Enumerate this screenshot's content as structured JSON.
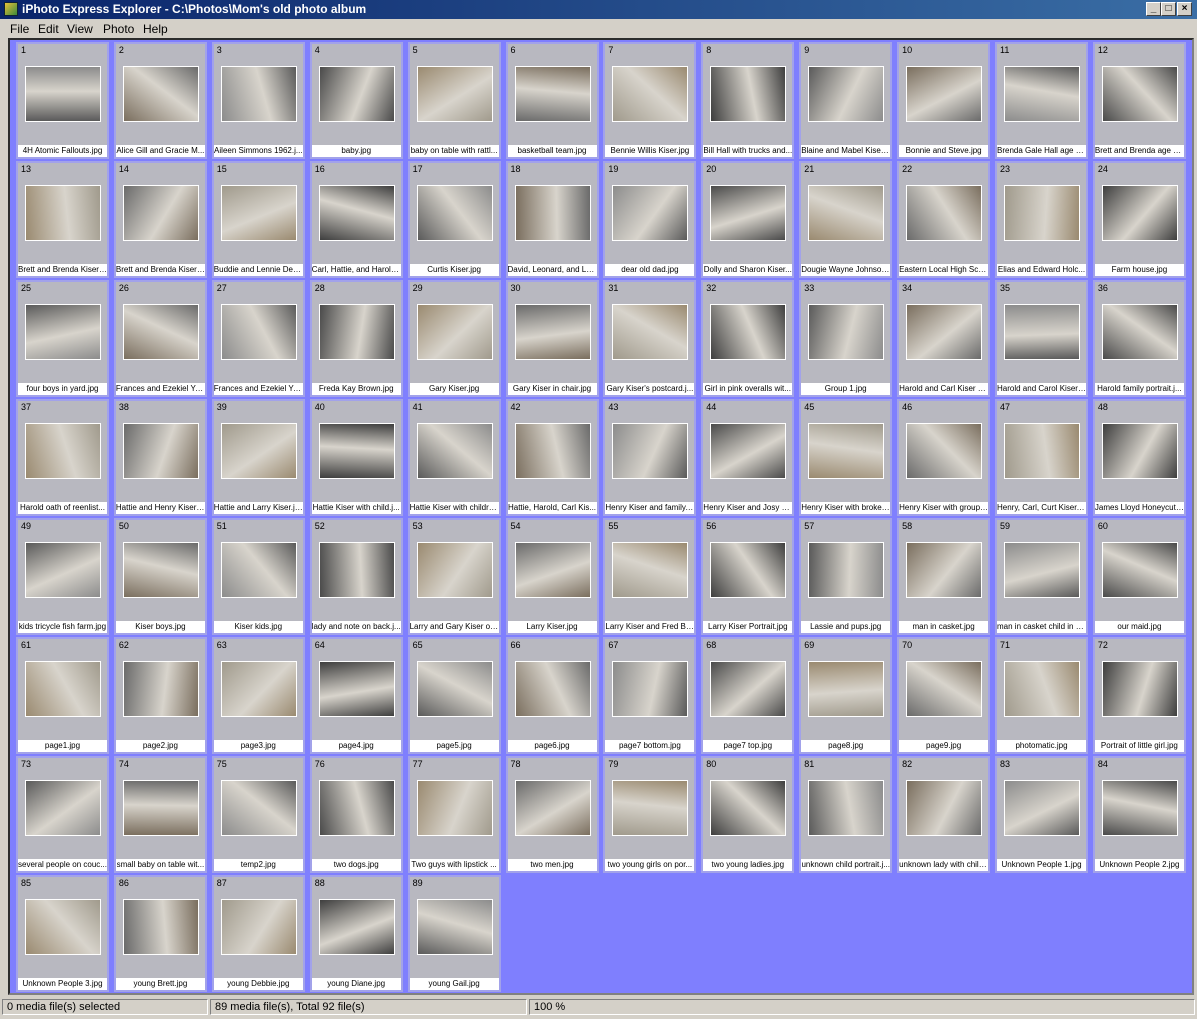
{
  "window": {
    "title": "iPhoto Express Explorer - C:\\Photos\\Mom's old photo album"
  },
  "menu": [
    "File",
    "Edit",
    "View",
    "Photo",
    "Help"
  ],
  "colors": {
    "grid_background": "#7f7ffe",
    "tile_background": "#b8b8c0",
    "titlebar": "#0a246a"
  },
  "photos": [
    "4H Atomic Fallouts.jpg",
    "Alice Gill and Gracie M...",
    "Aileen Simmons 1962.j...",
    "baby.jpg",
    "baby on table with rattl...",
    "basketball team.jpg",
    "Bennie Willis Kiser.jpg",
    "Bill Hall with trucks and...",
    "Blaine and Mabel Kiser ...",
    "Bonnie and Steve.jpg",
    "Brenda Gale Hall age 1...",
    "Brett and Brenda age 1...",
    "Brett and Brenda Kiser ...",
    "Brett and Brenda Kiser ...",
    "Buddie and Lennie Des...",
    "Carl, Hattie, and Harold...",
    "Curtis Kiser.jpg",
    "David, Leonard, and Lar...",
    "dear old dad.jpg",
    "Dolly and Sharon Kiser...",
    "Dougie Wayne Johnson...",
    "Eastern Local High Sch...",
    "Elias and Edward Holc...",
    "Farm house.jpg",
    "four boys in yard.jpg",
    "Frances and Ezekiel Yo...",
    "Frances and Ezekiel Yo...",
    "Freda Kay Brown.jpg",
    "Gary Kiser.jpg",
    "Gary Kiser in chair.jpg",
    "Gary Kiser's postcard.j...",
    "Girl in pink overalls wit...",
    "Group 1.jpg",
    "Harold and Carl Kiser w...",
    "Harold and Carol Kiser ...",
    "Harold family portrait.j...",
    "Harold oath of reenlist...",
    "Hattie and Henry Kiser ...",
    "Hattie and Larry Kiser.jpg",
    "Hattie Kiser with child.j...",
    "Hattie Kiser with childre...",
    "Hattie, Harold, Carl Kis...",
    "Henry Kiser and family.j...",
    "Henry Kiser and Josy P...",
    "Henry Kiser with broken...",
    "Henry Kiser with group ...",
    "Henry, Carl, Curt Kiser.j...",
    "James Lloyd Honeycutt...",
    "kids tricycle fish farm.jpg",
    "Kiser boys.jpg",
    "Kiser kids.jpg",
    "lady and note on back.j...",
    "Larry and Gary Kiser on...",
    "Larry Kiser.jpg",
    "Larry Kiser and Fred Ba...",
    "Larry Kiser Portrait.jpg",
    "Lassie and pups.jpg",
    "man in casket.jpg",
    "man in casket child in b...",
    "our maid.jpg",
    "page1.jpg",
    "page2.jpg",
    "page3.jpg",
    "page4.jpg",
    "page5.jpg",
    "page6.jpg",
    "page7 bottom.jpg",
    "page7 top.jpg",
    "page8.jpg",
    "page9.jpg",
    "photomatic.jpg",
    "Portrait of little girl.jpg",
    "several people on couc...",
    "small baby on table wit...",
    "temp2.jpg",
    "two dogs.jpg",
    "Two guys with lipstick ...",
    "two men.jpg",
    "two young girls on por...",
    "two young ladies.jpg",
    "unknown child portrait.j...",
    "unknown lady with child...",
    "Unknown People 1.jpg",
    "Unknown People 2.jpg",
    "Unknown People 3.jpg",
    "young Brett.jpg",
    "young Debbie.jpg",
    "young Diane.jpg",
    "young Gail.jpg"
  ],
  "status": {
    "selected": "0 media file(s) selected",
    "totals": "89 media file(s), Total 92 file(s)",
    "zoom": "100 %"
  }
}
